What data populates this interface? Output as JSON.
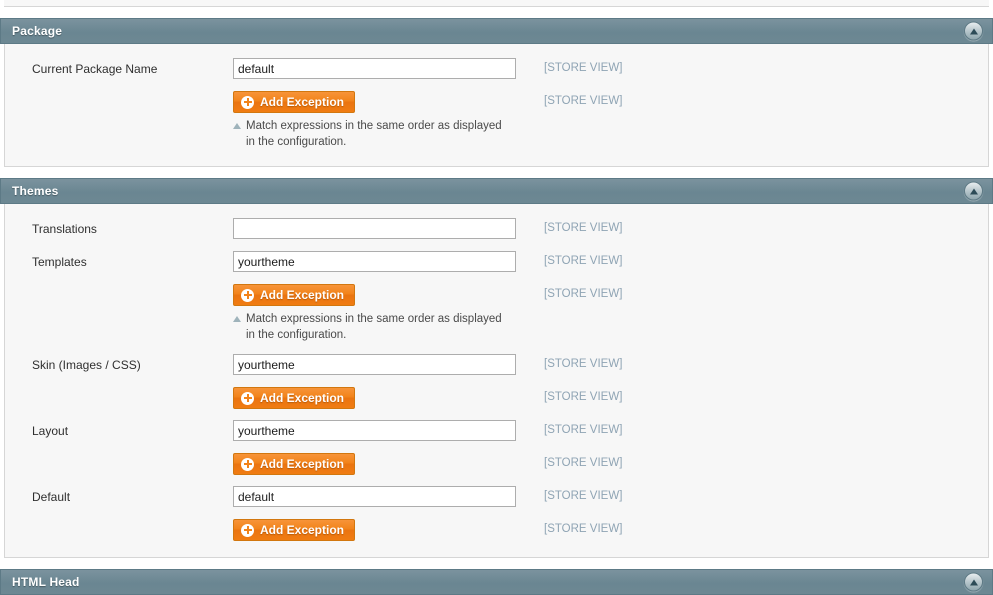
{
  "icons": {
    "collapse": "collapse-triangle-icon",
    "add": "plus-circle-icon",
    "hint": "hint-triangle-icon"
  },
  "colors": {
    "panel_header": "#6f8a96",
    "panel_body": "#f7f7f7",
    "button_orange": "#f2831a",
    "scope_label": "#8fa4b4",
    "input_border": "#adadad"
  },
  "common": {
    "add_exception_label": "Add Exception",
    "scope_store_view": "[STORE VIEW]",
    "hint_text": "Match expressions in the same order as displayed in the configuration."
  },
  "sections": [
    {
      "id": "package",
      "title": "Package",
      "rows": [
        {
          "label": "Current Package Name",
          "field_type": "input",
          "value": "default",
          "placeholder": "",
          "scope": "[STORE VIEW]"
        },
        {
          "label": "",
          "field_type": "button",
          "button_label": "Add Exception",
          "hint": "Match expressions in the same order as displayed in the configuration.",
          "scope": "[STORE VIEW]"
        }
      ]
    },
    {
      "id": "themes",
      "title": "Themes",
      "rows": [
        {
          "label": "Translations",
          "field_type": "input",
          "value": "",
          "placeholder": "",
          "scope": "[STORE VIEW]"
        },
        {
          "label": "Templates",
          "field_type": "input",
          "value": "yourtheme",
          "placeholder": "",
          "scope": "[STORE VIEW]"
        },
        {
          "label": "",
          "field_type": "button",
          "button_label": "Add Exception",
          "hint": "Match expressions in the same order as displayed in the configuration.",
          "scope": "[STORE VIEW]"
        },
        {
          "label": "Skin (Images / CSS)",
          "field_type": "input",
          "value": "yourtheme",
          "placeholder": "",
          "scope": "[STORE VIEW]"
        },
        {
          "label": "",
          "field_type": "button",
          "button_label": "Add Exception",
          "hint": "",
          "scope": "[STORE VIEW]"
        },
        {
          "label": "Layout",
          "field_type": "input",
          "value": "yourtheme",
          "placeholder": "",
          "scope": "[STORE VIEW]"
        },
        {
          "label": "",
          "field_type": "button",
          "button_label": "Add Exception",
          "hint": "",
          "scope": "[STORE VIEW]"
        },
        {
          "label": "Default",
          "field_type": "input",
          "value": "default",
          "placeholder": "",
          "scope": "[STORE VIEW]"
        },
        {
          "label": "",
          "field_type": "button",
          "button_label": "Add Exception",
          "hint": "",
          "scope": "[STORE VIEW]"
        }
      ]
    },
    {
      "id": "html-head",
      "title": "HTML Head",
      "rows": []
    }
  ]
}
